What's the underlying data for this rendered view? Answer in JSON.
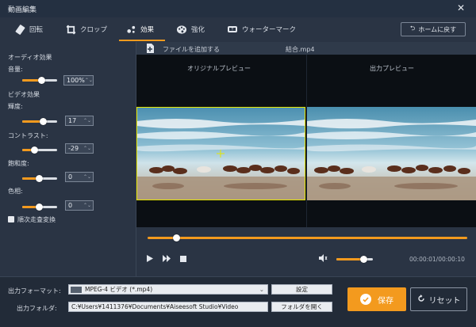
{
  "window": {
    "title": "動画編集"
  },
  "toolbar": {
    "tabs": [
      {
        "label": "回転",
        "icon": "rotate-icon"
      },
      {
        "label": "クロップ",
        "icon": "crop-icon"
      },
      {
        "label": "効果",
        "icon": "effect-icon"
      },
      {
        "label": "強化",
        "icon": "palette-icon"
      },
      {
        "label": "ウォーターマーク",
        "icon": "watermark-icon"
      }
    ],
    "active_tab": "効果",
    "home_label": "ホームに戻す"
  },
  "audio": {
    "section_label": "オーディオ効果",
    "volume_label": "音量:",
    "volume_value": "100%",
    "volume_level": 0.55
  },
  "video": {
    "section_label": "ビデオ効果",
    "brightness_label": "輝度:",
    "brightness_value": "17",
    "contrast_label": "コントラスト:",
    "contrast_value": "-29",
    "saturation_label": "飽和度:",
    "saturation_value": "0",
    "hue_label": "色相:",
    "hue_value": "0",
    "deinterlace_label": "順次走査変換"
  },
  "preview": {
    "add_file_label": "ファイルを追加する",
    "file_name": "結合.mp4",
    "original_label": "オリジナルプレビュー",
    "output_label": "出力プレビュー"
  },
  "playback": {
    "progress": 0.09,
    "volume_level": 0.73,
    "time": "00:00:01/00:00:10"
  },
  "output": {
    "format_label": "出力フォーマット:",
    "format_value": "MPEG-4 ビデオ (*.mp4)",
    "settings_label": "設定",
    "folder_label": "出力フォルダ:",
    "folder_value": "C:¥Users¥1411376¥Documents¥Aiseesoft Studio¥Video",
    "open_folder_label": "フォルダを開く",
    "save_label": "保存",
    "reset_label": "リセット"
  },
  "colors": {
    "accent": "#f39a1e",
    "background": "#2a3444"
  }
}
